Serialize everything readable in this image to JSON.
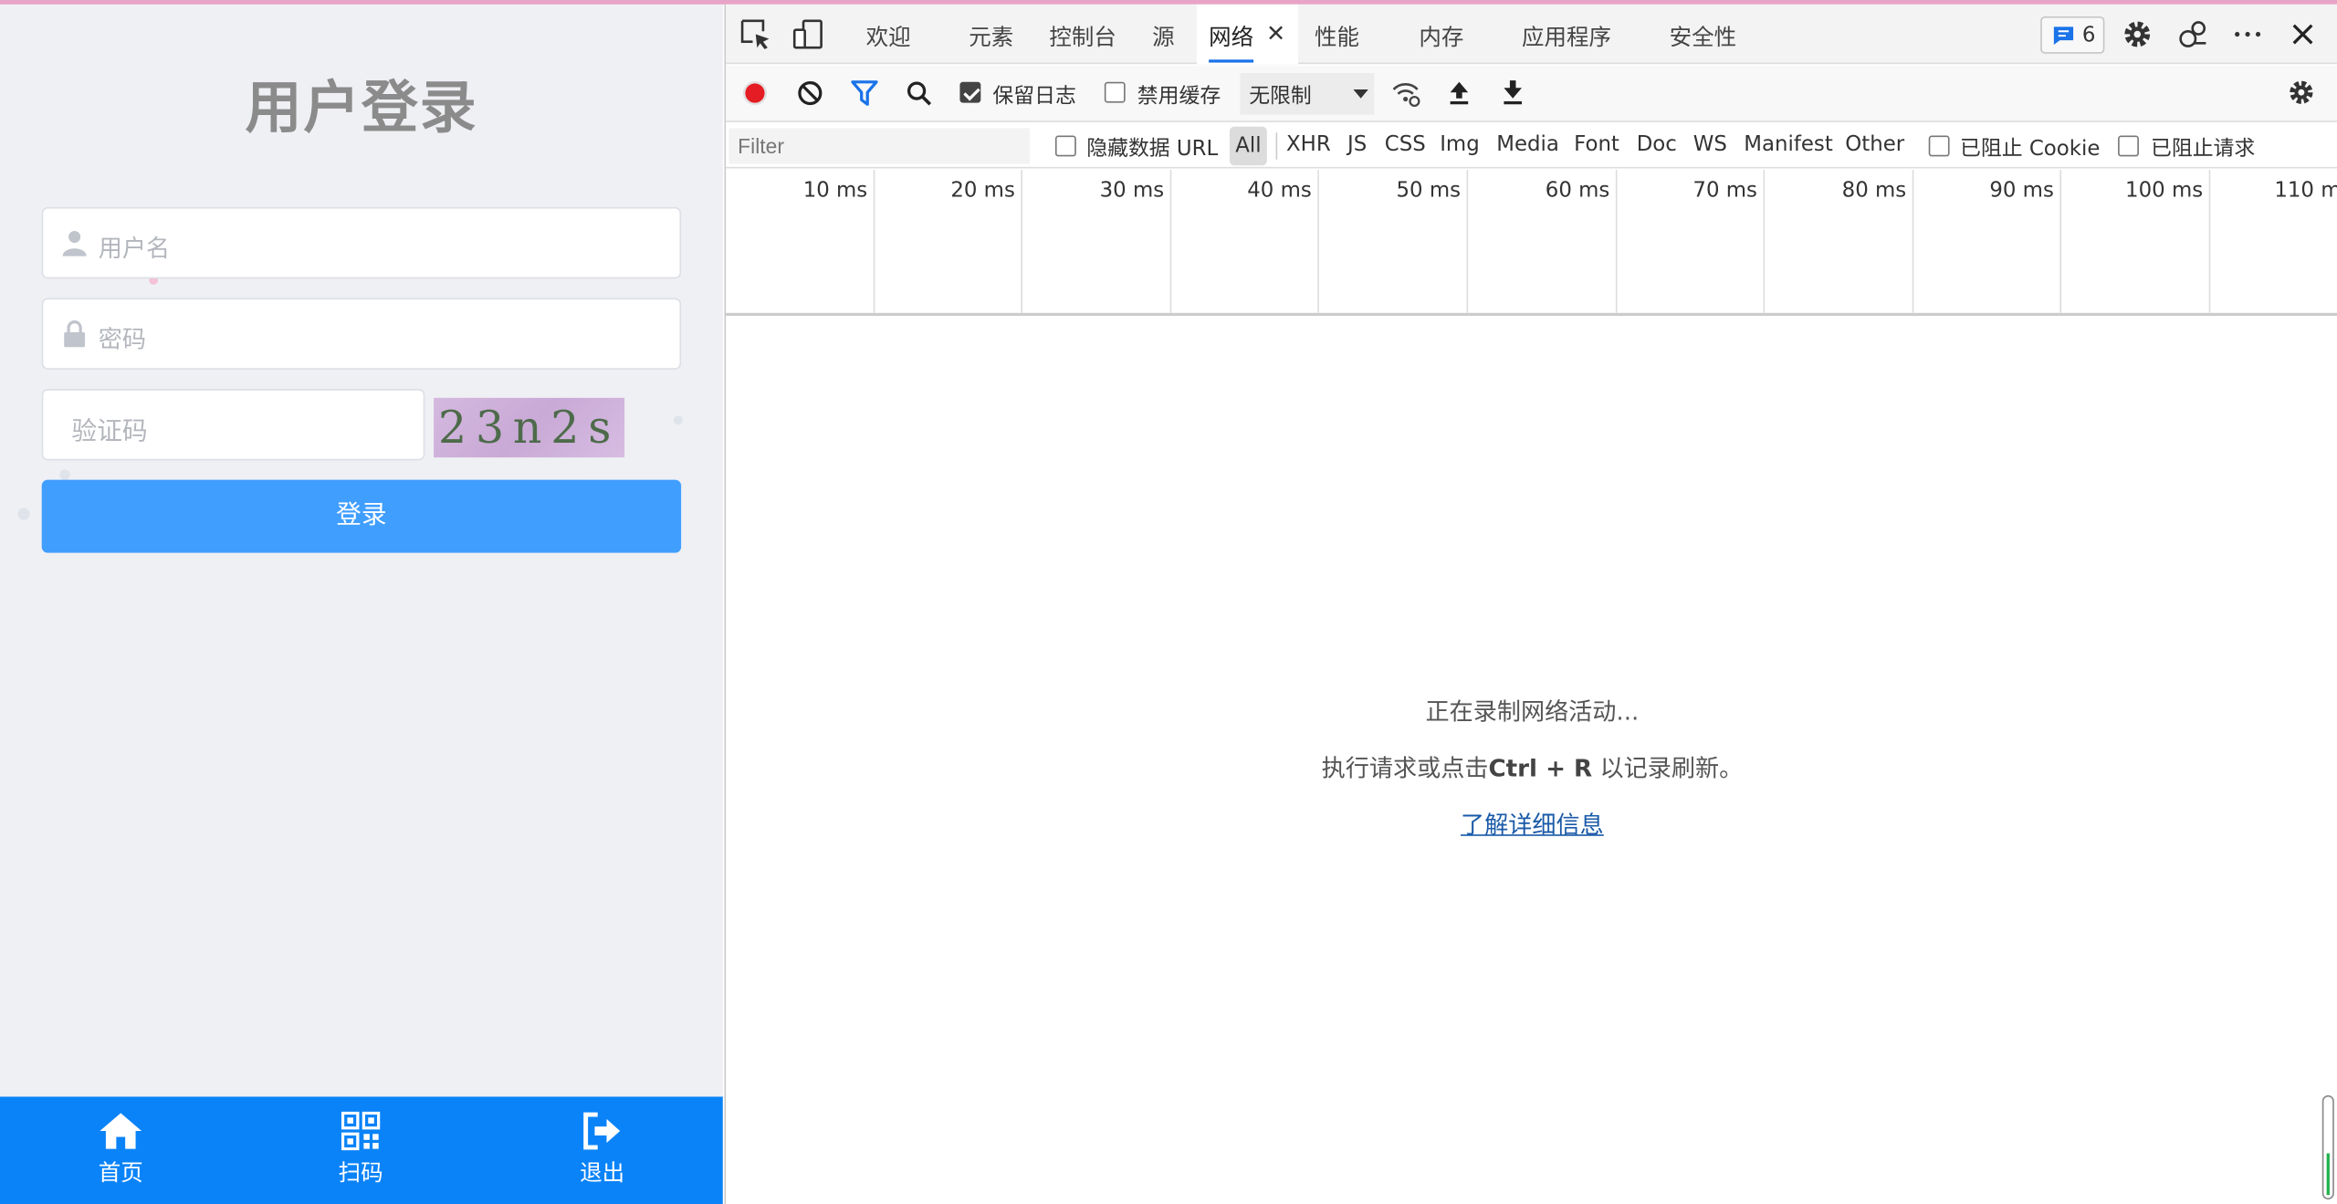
{
  "app": {
    "title": "用户登录",
    "username_placeholder": "用户名",
    "password_placeholder": "密码",
    "captcha_placeholder": "验证码",
    "captcha_text": "23n2s",
    "login_label": "登录",
    "nav": [
      {
        "label": "首页",
        "icon": "home-icon"
      },
      {
        "label": "扫码",
        "icon": "qrcode-icon"
      },
      {
        "label": "退出",
        "icon": "logout-icon"
      }
    ],
    "colors": {
      "primary": "#409eff",
      "nav_bg": "#0a83f8",
      "background": "#eff0f4"
    }
  },
  "devtools": {
    "tabs": [
      "欢迎",
      "元素",
      "控制台",
      "源",
      "网络",
      "性能",
      "内存",
      "应用程序",
      "安全性"
    ],
    "active_tab": "网络",
    "issues_count": "6",
    "toolbar": {
      "preserve_log_label": "保留日志",
      "preserve_log_checked": true,
      "disable_cache_label": "禁用缓存",
      "disable_cache_checked": false,
      "throttling_value": "无限制"
    },
    "filter": {
      "placeholder": "Filter",
      "hide_data_urls_label": "隐藏数据 URL",
      "types": [
        "All",
        "XHR",
        "JS",
        "CSS",
        "Img",
        "Media",
        "Font",
        "Doc",
        "WS",
        "Manifest",
        "Other"
      ],
      "active_type": "All",
      "blocked_cookies_label": "已阻止 Cookie",
      "blocked_requests_label": "已阻止请求"
    },
    "timeline_ticks": [
      "10 ms",
      "20 ms",
      "30 ms",
      "40 ms",
      "50 ms",
      "60 ms",
      "70 ms",
      "80 ms",
      "90 ms",
      "100 ms",
      "110 ms"
    ],
    "empty_state": {
      "line1": "正在录制网络活动...",
      "line2_prefix": "执行请求或点击",
      "line2_shortcut": "Ctrl + R",
      "line2_suffix": " 以记录刷新。",
      "link": "了解详细信息"
    }
  }
}
